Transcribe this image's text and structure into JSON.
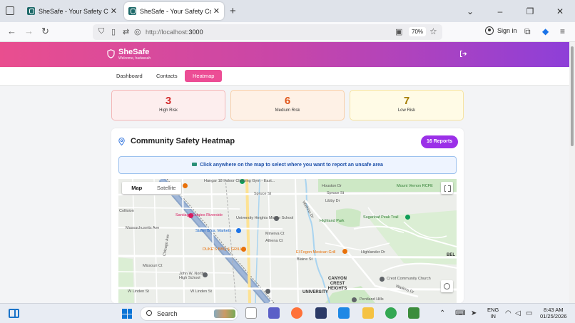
{
  "browser": {
    "tabs": [
      {
        "title": "SheSafe - Your Safety Companion",
        "close": "✕"
      },
      {
        "title": "SheSafe - Your Safety Companion",
        "close": "✕"
      }
    ],
    "new_tab": "+",
    "url_host": "http://localhost",
    "url_port": ":3000",
    "zoom": "70%",
    "sign_in": "Sign in"
  },
  "app": {
    "brand_name": "SheSafe",
    "welcome": "Welcome, hadassah",
    "nav": [
      "Dashboard",
      "Contacts",
      "Heatmap"
    ],
    "active_nav": "Heatmap",
    "colors": {
      "gradient_start": "#e94e8f",
      "gradient_end": "#8e3fd8",
      "accent": "#ec4d95",
      "badge": "#9b30e8"
    }
  },
  "stats": [
    {
      "value": "3",
      "label": "High Risk",
      "color": "#d32f2f"
    },
    {
      "value": "6",
      "label": "Medium Risk",
      "color": "#e0561b"
    },
    {
      "value": "7",
      "label": "Low Risk",
      "color": "#a57d00"
    }
  ],
  "heatmap": {
    "title": "Community Safety Heatmap",
    "reports_badge": "16 Reports",
    "instruction": "Click anywhere on the map to select where you want to report an unsafe area",
    "map_type_options": [
      "Map",
      "Satellite"
    ],
    "selected_map_type": "Map",
    "map_labels": {
      "climbing_gym": "Hangar 18 Indoor Climbing Gym - East...",
      "spruce_st_1": "Spruce St",
      "spruce_st_2": "Spruce St",
      "houston_dr": "Houston Dr",
      "libby_dr": "Libby Dr",
      "mount_vernon": "Mount Vernon RCFE",
      "collision": "Collision",
      "santiago": "Santiago Estates Riverside",
      "university_heights": "University Heights Middle School",
      "highland_park": "Highland Park",
      "sugarloaf": "Sugarloaf Peak Trail",
      "massachusetts": "Massachusetts Ave",
      "stater_bros": "Stater Bros. Markets",
      "minerva": "Minerva Ct",
      "athena": "Athena Ct",
      "dukes": "DUKE'S BBQ & GRILL",
      "el_fogon": "El Fogon Mexican Grill",
      "blaine": "Blaine St",
      "missouri": "Missouri Ct",
      "john_north": "John W. North High School",
      "canyon_crest": "CANYON CREST HEIGHTS",
      "crest_church": "Crest Community Church",
      "university": "UNIVERSITY",
      "pentland": "Pentland Hills",
      "w_linden_1": "W Linden St",
      "w_linden_2": "W Linden St",
      "watkins_1": "Watkins Dr",
      "watkins_2": "Watkins Dr",
      "chicago_ave": "Chicago Ave",
      "highlander": "Highlander Dr",
      "bel": "BEL"
    }
  },
  "taskbar": {
    "search_placeholder": "Search",
    "lang_line1": "ENG",
    "lang_line2": "IN",
    "time": "8:43 AM",
    "date": "01/25/2026"
  }
}
